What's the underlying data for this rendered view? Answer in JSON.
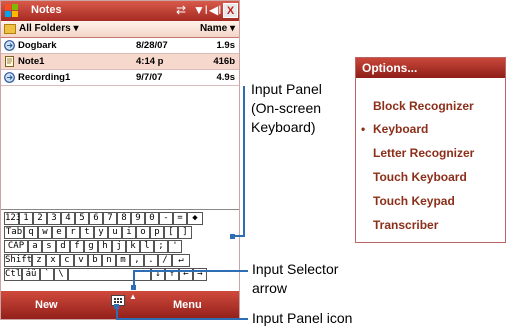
{
  "window": {
    "title": "Notes",
    "close_label": "X",
    "status_icons": [
      "sync-icon",
      "signal-icon",
      "volume-icon"
    ]
  },
  "folder_bar": {
    "folder": "All Folders ▾",
    "sort": "Name ▾"
  },
  "notes": [
    {
      "name": "Dogbark",
      "date": "8/28/07",
      "size": "1.9s",
      "icon": "voice-note-icon"
    },
    {
      "name": "Note1",
      "date": "4:14 p",
      "size": "416b",
      "icon": "text-note-icon"
    },
    {
      "name": "Recording1",
      "date": "9/7/07",
      "size": "4.9s",
      "icon": "voice-note-icon"
    }
  ],
  "keyboard": {
    "rows": [
      [
        "123",
        "1",
        "2",
        "3",
        "4",
        "5",
        "6",
        "7",
        "8",
        "9",
        "0",
        "-",
        "=",
        "◆"
      ],
      [
        "Tab",
        "q",
        "w",
        "e",
        "r",
        "t",
        "y",
        "u",
        "i",
        "o",
        "p",
        "[",
        "]"
      ],
      [
        "CAP",
        "a",
        "s",
        "d",
        "f",
        "g",
        "h",
        "j",
        "k",
        "l",
        ";",
        "'"
      ],
      [
        "Shift",
        "z",
        "x",
        "c",
        "v",
        "b",
        "n",
        "m",
        ",",
        ".",
        "/",
        "↵"
      ],
      [
        "Ctl",
        "áü",
        "`",
        "\\",
        "",
        "↓",
        "↑",
        "←",
        "→"
      ]
    ]
  },
  "menubar": {
    "left": "New",
    "right": "Menu",
    "input_icon": "keyboard-icon",
    "selector": "▲"
  },
  "callouts": {
    "input_panel": [
      "Input Panel",
      "(On-screen",
      "Keyboard)"
    ],
    "input_selector": [
      "Input Selector",
      "arrow"
    ],
    "input_panel_icon": "Input Panel icon"
  },
  "options_menu": {
    "title": "Options...",
    "items": [
      {
        "label": "Block Recognizer",
        "selected": false
      },
      {
        "label": "Keyboard",
        "selected": true
      },
      {
        "label": "Letter Recognizer",
        "selected": false
      },
      {
        "label": "Touch Keyboard",
        "selected": false
      },
      {
        "label": "Touch Keypad",
        "selected": false
      },
      {
        "label": "Transcriber",
        "selected": false
      }
    ],
    "bullet": "•"
  },
  "colors": {
    "title_bar": "#b83a2e",
    "selection": "#f6d8cc",
    "menu_text": "#8c2f1a",
    "callout_line": "#2f6db5"
  }
}
